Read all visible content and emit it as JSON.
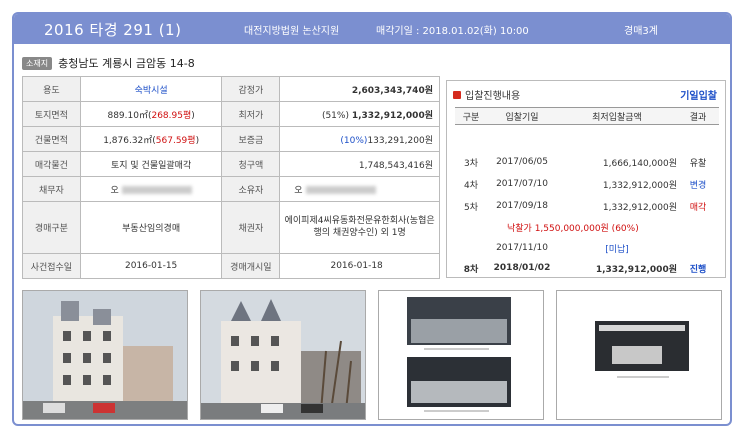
{
  "header": {
    "case_no": "2016 타경 291 (1)",
    "court": "대전지방법원 논산지원",
    "sale_date": "매각기일 : 2018.01.02(화) 10:00",
    "auction_type": "경매3계"
  },
  "address": {
    "tag": "소재지",
    "text": "충청남도 계룡시 금암동 14-8"
  },
  "info": {
    "r1": {
      "l1": "용도",
      "v1": "숙박시설",
      "l2": "감정가",
      "v2": "2,603,343,740원"
    },
    "r2": {
      "l1": "토지면적",
      "v1a": "889.10㎡(",
      "v1b": "268.95평",
      "v1c": ")",
      "l2": "최저가",
      "v2a": "(51%) ",
      "v2b": "1,332,912,000원"
    },
    "r3": {
      "l1": "건물면적",
      "v1a": "1,876.32㎡(",
      "v1b": "567.59평",
      "v1c": ")",
      "l2": "보증금",
      "v2a": "(10%)",
      "v2b": "133,291,200원"
    },
    "r4": {
      "l1": "매각물건",
      "v1": "토지 및 건물일괄매각",
      "l2": "청구액",
      "v2": "1,748,543,416원"
    },
    "r5": {
      "l1": "채무자",
      "v1": "오",
      "l2": "소유자",
      "v2": "오"
    },
    "r6": {
      "l1": "경매구분",
      "v1": "부동산임의경매",
      "l2": "채권자",
      "v2": "에이피제4씨유동화전문유한회사(농협은행의 채권양수인) 외 1명"
    },
    "r7": {
      "l1": "사건접수일",
      "v1": "2016-01-15",
      "l2": "경매개시일",
      "v2": "2016-01-18"
    }
  },
  "auction": {
    "title": "입찰진행내용",
    "link": "기일입찰",
    "columns": [
      "구분",
      "입찰기일",
      "최저입찰금액",
      "결과"
    ],
    "rows": [
      {
        "round": "3차",
        "date": "2017/06/05",
        "price": "1,666,140,000원",
        "result": "유찰"
      },
      {
        "round": "4차",
        "date": "2017/07/10",
        "price": "1,332,912,000원",
        "result": "변경"
      },
      {
        "round": "5차",
        "date": "2017/09/18",
        "price": "1,332,912,000원",
        "result": "매각"
      }
    ],
    "sold_text": "낙찰가 1,550,000,000원 (60%)",
    "unpaid": {
      "date": "2017/11/10",
      "result": "[미납]"
    },
    "current": {
      "round": "8차",
      "date": "2018/01/02",
      "price": "1,332,912,000원",
      "result": "진행"
    }
  },
  "photos": [
    "building-photo-1",
    "building-photo-2",
    "parking-photo-document",
    "carport-photo-document"
  ]
}
